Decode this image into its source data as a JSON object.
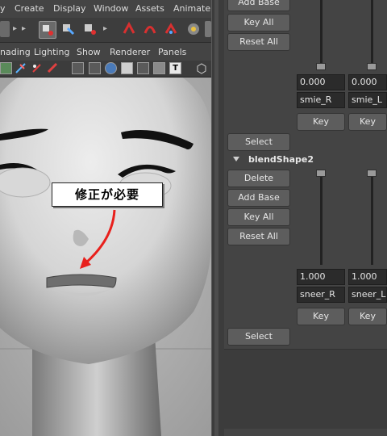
{
  "menubar": {
    "items": [
      "y",
      "Create",
      "Display",
      "Window",
      "Assets",
      "Animate"
    ]
  },
  "panelbar": {
    "items": [
      "nading",
      "Lighting",
      "Show",
      "Renderer",
      "Panels"
    ]
  },
  "annotation": {
    "callout_text": "修正が必要",
    "arrow_color": "#e8201c"
  },
  "blend_top": {
    "add_base_label": "Add Base",
    "key_all_label": "Key All",
    "reset_all_label": "Reset All",
    "values": [
      "0.000",
      "0.000"
    ],
    "names": [
      "smie_R",
      "smie_L"
    ],
    "key_labels": [
      "Key",
      "Key"
    ],
    "select_label": "Select"
  },
  "blend_shape2": {
    "title": "blendShape2",
    "delete_label": "Delete",
    "add_base_label": "Add Base",
    "key_all_label": "Key All",
    "reset_all_label": "Reset All",
    "values": [
      "1.000",
      "1.000"
    ],
    "names": [
      "sneer_R",
      "sneer_L"
    ],
    "key_labels": [
      "Key",
      "Key"
    ],
    "select_label": "Select"
  },
  "colors": {
    "panel_bg": "#444444",
    "viewport_bg": "#b7b7b7",
    "field_bg": "#2b2b2b"
  }
}
